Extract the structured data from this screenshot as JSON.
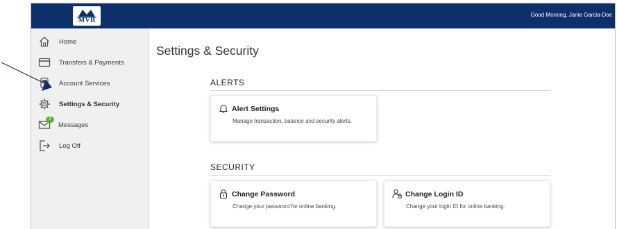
{
  "header": {
    "logo_text": "MVB",
    "greeting": "Good Morning, Janie Garcia-Doe",
    "bg_color": "#0d2f6b"
  },
  "sidebar": {
    "items": [
      {
        "label": "Home",
        "icon": "home-icon"
      },
      {
        "label": "Transfers & Payments",
        "icon": "card-icon"
      },
      {
        "label": "Account Services",
        "icon": "account-services-icon"
      },
      {
        "label": "Settings & Security",
        "icon": "gear-icon",
        "active": true
      },
      {
        "label": "Messages",
        "icon": "envelope-icon",
        "badge": "2"
      },
      {
        "label": "Log Off",
        "icon": "logout-icon"
      }
    ]
  },
  "main": {
    "page_title": "Settings & Security",
    "sections": [
      {
        "title": "ALERTS",
        "cards": [
          {
            "title": "Alert Settings",
            "description": "Manage transaction, balance and security alerts.",
            "icon": "bell-icon"
          }
        ]
      },
      {
        "title": "SECURITY",
        "cards": [
          {
            "title": "Change Password",
            "description": "Change your password for online banking.",
            "icon": "lock-icon"
          },
          {
            "title": "Change Login ID",
            "description": "Change your login ID for online banking.",
            "icon": "user-key-icon"
          }
        ]
      }
    ]
  }
}
